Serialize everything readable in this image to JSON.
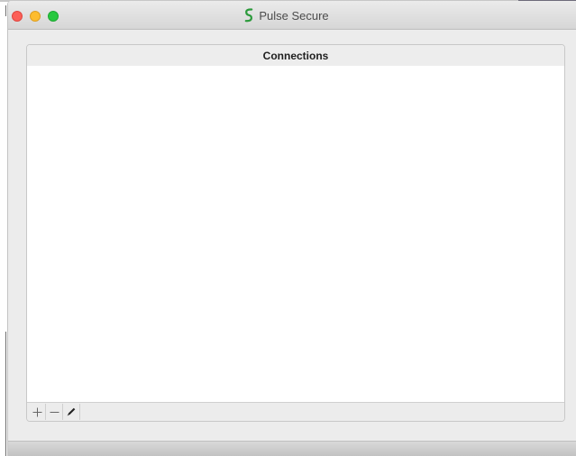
{
  "window": {
    "title": "Pulse Secure"
  },
  "icons": {
    "close": "close-window-icon",
    "minimize": "minimize-window-icon",
    "zoom": "zoom-window-icon",
    "app_logo": "pulse-secure-logo-icon",
    "add": "plus-icon",
    "remove": "minus-icon",
    "edit": "pencil-icon"
  },
  "colors": {
    "close": "#fc5f57",
    "minimize": "#fdbc2e",
    "zoom": "#28c840",
    "logo": "#2b9a3b"
  },
  "connections": {
    "header": "Connections",
    "items": []
  }
}
